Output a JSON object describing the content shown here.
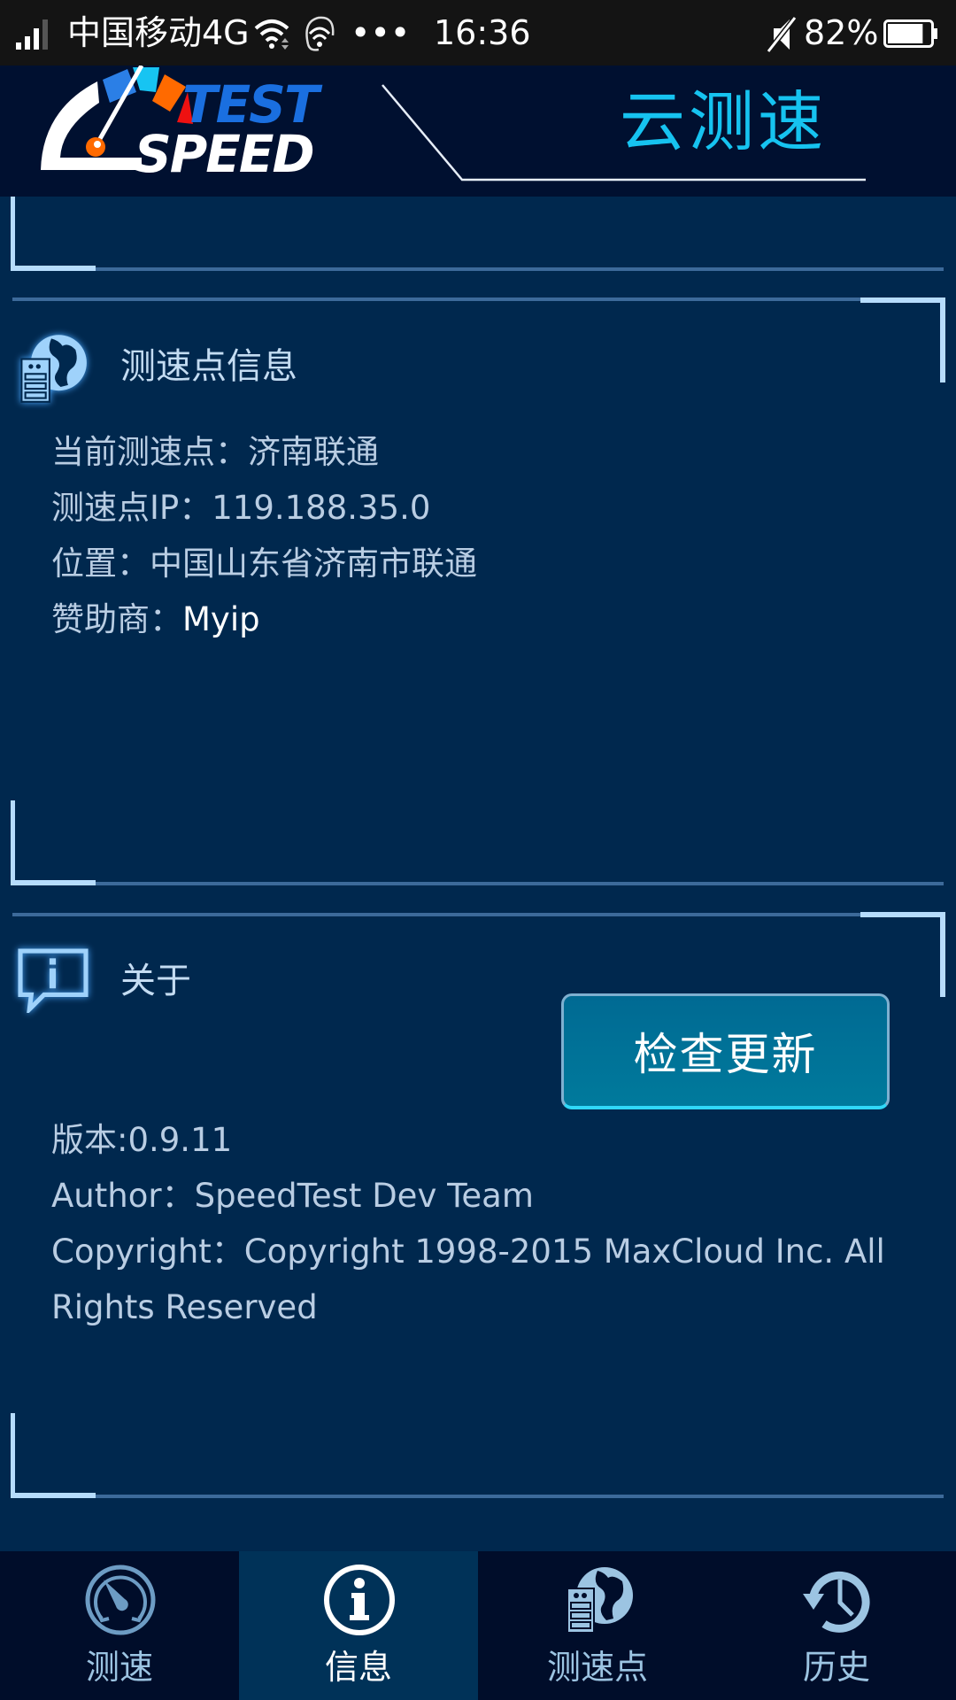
{
  "status_bar": {
    "carrier": "中国移动4G",
    "dots": "•••",
    "time": "16:36",
    "battery_percent": "82%",
    "battery_level": 0.82,
    "icons": [
      "signal-icon",
      "wifi-icon",
      "hotspot-icon",
      "mute-icon",
      "battery-icon"
    ]
  },
  "header": {
    "logo_text_top": "TEST",
    "logo_text_bottom": "SPEED",
    "title": "云测速"
  },
  "server_info": {
    "heading": "测速点信息",
    "icon": "server-globe-icon",
    "rows": [
      {
        "label": "当前测速点：",
        "value": "济南联通"
      },
      {
        "label": "测速点IP：",
        "value": "119.188.35.0"
      },
      {
        "label": "位置：",
        "value": "中国山东省济南市联通"
      },
      {
        "label": "赞助商：",
        "value": "Myip"
      }
    ]
  },
  "about": {
    "heading": "关于",
    "icon": "info-bubble-icon",
    "check_update_label": "检查更新",
    "version": "版本:0.9.11",
    "author_label": "Author：",
    "author_value": "SpeedTest Dev Team",
    "copyright_label": "Copyright：",
    "copyright_value": "Copyright 1998-2015 MaxCloud Inc. All Rights Reserved"
  },
  "tabbar": {
    "active_index": 1,
    "tabs": [
      {
        "label": "测速",
        "icon": "speedometer-icon"
      },
      {
        "label": "信息",
        "icon": "info-icon"
      },
      {
        "label": "测速点",
        "icon": "server-globe-icon"
      },
      {
        "label": "历史",
        "icon": "history-icon"
      }
    ]
  },
  "colors": {
    "background": "#00284e",
    "header_bg": "#001030",
    "status_bar_bg": "#141414",
    "title_cyan": "#16c3f0",
    "bracket": "#b6dcfc",
    "divider": "#3c6a9a",
    "tabbar_bg": "#000d2a",
    "tab_active_bg": "#003258",
    "button_bg": "#006a93"
  }
}
